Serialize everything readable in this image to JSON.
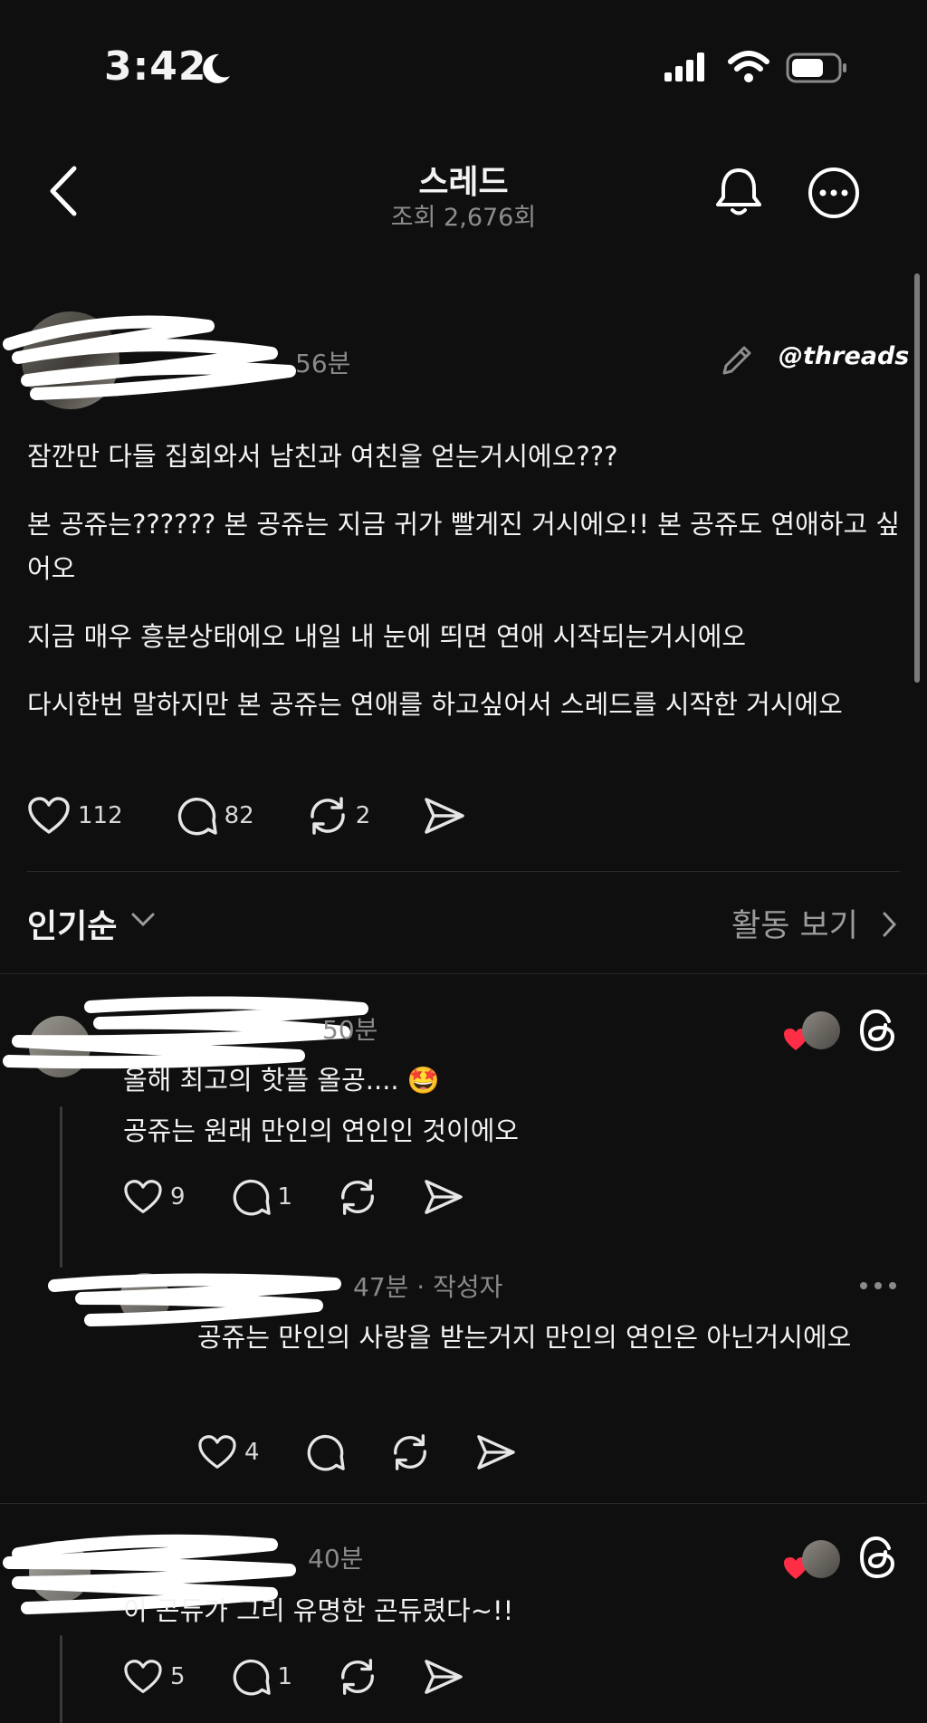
{
  "status": {
    "time": "3:42"
  },
  "nav": {
    "title": "스레드",
    "views": "조회 2,676회"
  },
  "post": {
    "time": "56분",
    "brand": "threads",
    "paragraphs": [
      "잠깐만 다들 집회와서 남친과 여친을 얻는거시에오???",
      "본 공쥬는?????? 본 공쥬는 지금 귀가 빨게진 거시에오!! 본 공쥬도 연애하고 싶어오",
      "지금 매우 흥분상태에오 내일 내 눈에 띄면 연애 시작되는거시에오",
      "다시한번 말하지만 본 공쥬는 연애를 하고싶어서 스레드를 시작한 거시에오"
    ],
    "likes": "112",
    "comments": "82",
    "reposts": "2"
  },
  "sort": {
    "label": "인기순",
    "activity": "활동 보기"
  },
  "comments": [
    {
      "time": "50분",
      "lines": [
        "올해 최고의 핫플 올공.... 🤩",
        "공쥬는 원래 만인의 연인인 것이에오"
      ],
      "likes": "9",
      "replies": "1",
      "reply": {
        "time": "47분",
        "badge": "작성자",
        "text": "공쥬는 만인의 사랑을 받는거지 만인의 연인은 아닌거시에오",
        "likes": "4"
      }
    },
    {
      "time": "40분",
      "lines": [
        "이 곤듀가 그리 유명한 곤듀렸다~!!"
      ],
      "likes": "5",
      "replies": "1"
    }
  ]
}
